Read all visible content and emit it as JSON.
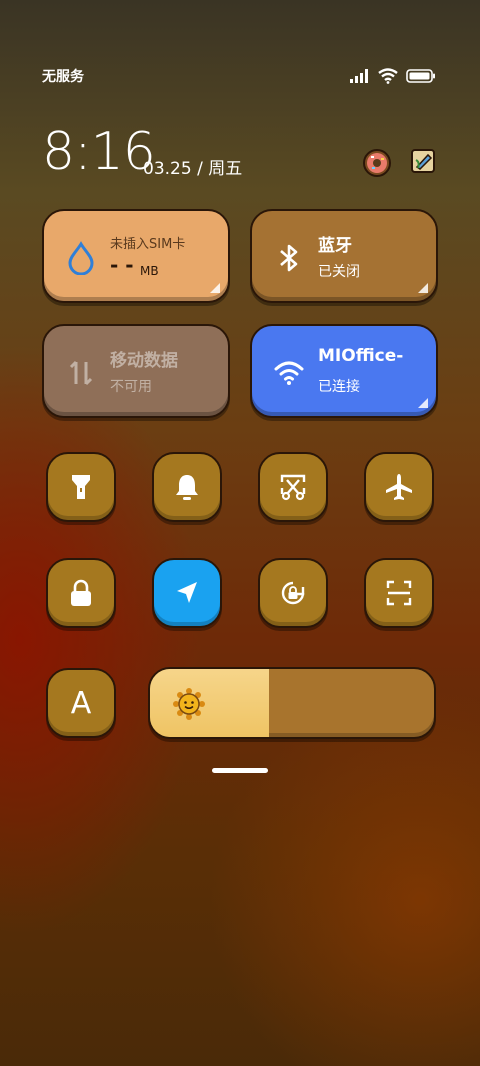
{
  "status_bar": {
    "carrier": "无服务"
  },
  "clock": {
    "time": "8:16",
    "date": "03.25 / 周五"
  },
  "tiles": {
    "mobile_data_usage": {
      "title": "未插入SIM卡",
      "value": "- -",
      "unit": "MB"
    },
    "bluetooth": {
      "title": "蓝牙",
      "status": "已关闭"
    },
    "mobile_data": {
      "title": "移动数据",
      "status": "不可用"
    },
    "wifi": {
      "title": "MIOffice-",
      "status": "已连接"
    }
  },
  "toggles": [
    {
      "name": "flashlight",
      "active": false
    },
    {
      "name": "silent",
      "active": false
    },
    {
      "name": "screenshot",
      "active": false
    },
    {
      "name": "airplane-mode",
      "active": false
    },
    {
      "name": "lock-screen",
      "active": false
    },
    {
      "name": "location",
      "active": true
    },
    {
      "name": "rotation-lock",
      "active": false
    },
    {
      "name": "scanner",
      "active": false
    },
    {
      "name": "auto-brightness",
      "active": false,
      "label": "A"
    }
  ],
  "brightness": {
    "level": 0.42
  },
  "colors": {
    "tile_orange": "#e8a86a",
    "tile_brown": "#a57233",
    "tile_disabled": "#8f6f58",
    "tile_wifi": "#4a78f0",
    "button": "#a5781f",
    "button_active": "#1aa2f0"
  }
}
